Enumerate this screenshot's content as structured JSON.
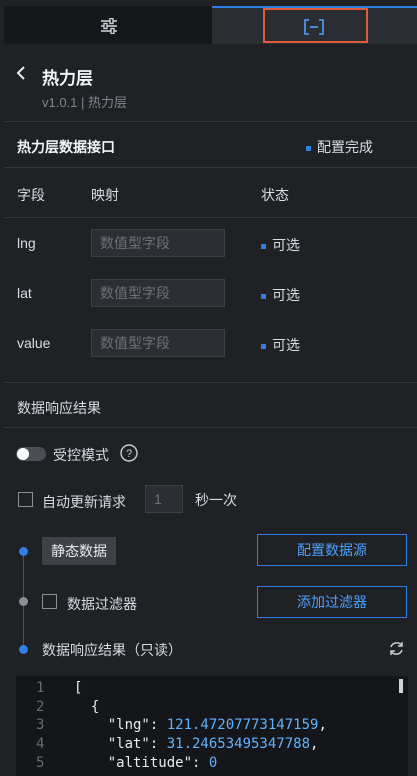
{
  "panel": {
    "title": "热力层",
    "subtitle": "v1.0.1 | 热力层"
  },
  "interface": {
    "title": "热力层数据接口",
    "status": "配置完成",
    "headers": {
      "field": "字段",
      "mapping": "映射",
      "state": "状态"
    },
    "rows": [
      {
        "field": "lng",
        "placeholder": "数值型字段",
        "state": "可选"
      },
      {
        "field": "lat",
        "placeholder": "数值型字段",
        "state": "可选"
      },
      {
        "field": "value",
        "placeholder": "数值型字段",
        "state": "可选"
      }
    ]
  },
  "response": {
    "section_title": "数据响应结果",
    "controlled_label": "受控模式",
    "auto_update_label": "自动更新请求",
    "interval_value": "1",
    "interval_unit": "秒一次",
    "static_data": "静态数据",
    "config_source_btn": "配置数据源",
    "filter_label": "数据过滤器",
    "add_filter_btn": "添加过滤器",
    "result_label": "数据响应结果（只读）"
  },
  "code_lines": [
    {
      "n": "1",
      "text": "["
    },
    {
      "n": "2",
      "text": "  {"
    },
    {
      "n": "3",
      "key": "    \"lng\": ",
      "val": "121.47207773147159",
      "tail": ","
    },
    {
      "n": "4",
      "key": "    \"lat\": ",
      "val": "31.24653495347788",
      "tail": ","
    },
    {
      "n": "5",
      "key": "    \"altitude\": ",
      "val": "0",
      "tail": ""
    }
  ],
  "colors": {
    "accent": "#2f7fe6",
    "highlight_box": "#e25a3c",
    "bg": "#1f2124"
  }
}
